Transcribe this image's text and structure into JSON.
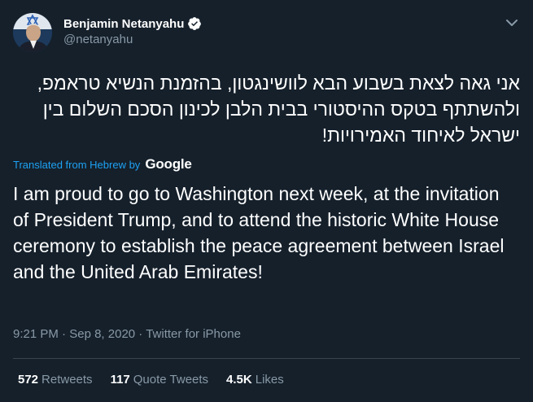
{
  "author": {
    "display_name": "Benjamin Netanyahu",
    "handle": "@netanyahu",
    "verified": true
  },
  "tweet": {
    "original_text": "אני גאה לצאת בשבוע הבא לוושינגטון, בהזמנת הנשיא טראמפ, ולהשתתף בטקס ההיסטורי בבית הלבן לכינון הסכם השלום בין ישראל לאיחוד האמירויות!",
    "translated_label": "Translated from Hebrew by",
    "translator": "Google",
    "translated_text": "I am proud to go to Washington next week, at the invitation of President Trump, and to attend the historic White House ceremony to establish the peace agreement between Israel and the United Arab Emirates!",
    "time": "9:21 PM",
    "date": "Sep 8, 2020",
    "source": "Twitter for iPhone",
    "separator": "·"
  },
  "stats": {
    "retweets_count": "572",
    "retweets_label": "Retweets",
    "quotes_count": "117",
    "quotes_label": "Quote Tweets",
    "likes_count": "4.5K",
    "likes_label": "Likes"
  },
  "colors": {
    "background": "#15202b",
    "secondary_text": "#8899a6",
    "link": "#1da1f2",
    "divider": "#38444d"
  },
  "icons": {
    "verified": "verified-badge-icon",
    "more": "chevron-down-icon"
  }
}
